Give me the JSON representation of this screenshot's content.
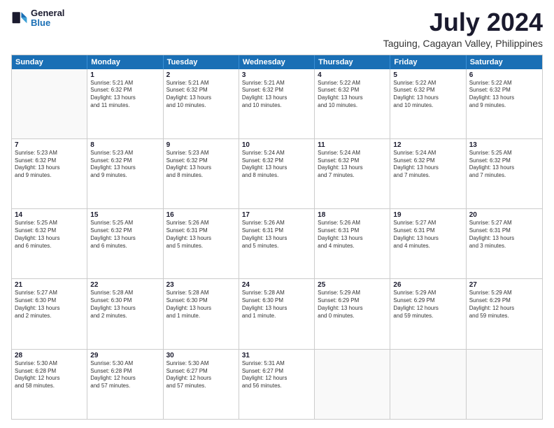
{
  "logo": {
    "line1": "General",
    "line2": "Blue"
  },
  "title": "July 2024",
  "subtitle": "Taguing, Cagayan Valley, Philippines",
  "header": {
    "days": [
      "Sunday",
      "Monday",
      "Tuesday",
      "Wednesday",
      "Thursday",
      "Friday",
      "Saturday"
    ]
  },
  "weeks": [
    [
      {
        "day": "",
        "info": ""
      },
      {
        "day": "1",
        "info": "Sunrise: 5:21 AM\nSunset: 6:32 PM\nDaylight: 13 hours\nand 11 minutes."
      },
      {
        "day": "2",
        "info": "Sunrise: 5:21 AM\nSunset: 6:32 PM\nDaylight: 13 hours\nand 10 minutes."
      },
      {
        "day": "3",
        "info": "Sunrise: 5:21 AM\nSunset: 6:32 PM\nDaylight: 13 hours\nand 10 minutes."
      },
      {
        "day": "4",
        "info": "Sunrise: 5:22 AM\nSunset: 6:32 PM\nDaylight: 13 hours\nand 10 minutes."
      },
      {
        "day": "5",
        "info": "Sunrise: 5:22 AM\nSunset: 6:32 PM\nDaylight: 13 hours\nand 10 minutes."
      },
      {
        "day": "6",
        "info": "Sunrise: 5:22 AM\nSunset: 6:32 PM\nDaylight: 13 hours\nand 9 minutes."
      }
    ],
    [
      {
        "day": "7",
        "info": "Sunrise: 5:23 AM\nSunset: 6:32 PM\nDaylight: 13 hours\nand 9 minutes."
      },
      {
        "day": "8",
        "info": "Sunrise: 5:23 AM\nSunset: 6:32 PM\nDaylight: 13 hours\nand 9 minutes."
      },
      {
        "day": "9",
        "info": "Sunrise: 5:23 AM\nSunset: 6:32 PM\nDaylight: 13 hours\nand 8 minutes."
      },
      {
        "day": "10",
        "info": "Sunrise: 5:24 AM\nSunset: 6:32 PM\nDaylight: 13 hours\nand 8 minutes."
      },
      {
        "day": "11",
        "info": "Sunrise: 5:24 AM\nSunset: 6:32 PM\nDaylight: 13 hours\nand 7 minutes."
      },
      {
        "day": "12",
        "info": "Sunrise: 5:24 AM\nSunset: 6:32 PM\nDaylight: 13 hours\nand 7 minutes."
      },
      {
        "day": "13",
        "info": "Sunrise: 5:25 AM\nSunset: 6:32 PM\nDaylight: 13 hours\nand 7 minutes."
      }
    ],
    [
      {
        "day": "14",
        "info": "Sunrise: 5:25 AM\nSunset: 6:32 PM\nDaylight: 13 hours\nand 6 minutes."
      },
      {
        "day": "15",
        "info": "Sunrise: 5:25 AM\nSunset: 6:32 PM\nDaylight: 13 hours\nand 6 minutes."
      },
      {
        "day": "16",
        "info": "Sunrise: 5:26 AM\nSunset: 6:31 PM\nDaylight: 13 hours\nand 5 minutes."
      },
      {
        "day": "17",
        "info": "Sunrise: 5:26 AM\nSunset: 6:31 PM\nDaylight: 13 hours\nand 5 minutes."
      },
      {
        "day": "18",
        "info": "Sunrise: 5:26 AM\nSunset: 6:31 PM\nDaylight: 13 hours\nand 4 minutes."
      },
      {
        "day": "19",
        "info": "Sunrise: 5:27 AM\nSunset: 6:31 PM\nDaylight: 13 hours\nand 4 minutes."
      },
      {
        "day": "20",
        "info": "Sunrise: 5:27 AM\nSunset: 6:31 PM\nDaylight: 13 hours\nand 3 minutes."
      }
    ],
    [
      {
        "day": "21",
        "info": "Sunrise: 5:27 AM\nSunset: 6:30 PM\nDaylight: 13 hours\nand 2 minutes."
      },
      {
        "day": "22",
        "info": "Sunrise: 5:28 AM\nSunset: 6:30 PM\nDaylight: 13 hours\nand 2 minutes."
      },
      {
        "day": "23",
        "info": "Sunrise: 5:28 AM\nSunset: 6:30 PM\nDaylight: 13 hours\nand 1 minute."
      },
      {
        "day": "24",
        "info": "Sunrise: 5:28 AM\nSunset: 6:30 PM\nDaylight: 13 hours\nand 1 minute."
      },
      {
        "day": "25",
        "info": "Sunrise: 5:29 AM\nSunset: 6:29 PM\nDaylight: 13 hours\nand 0 minutes."
      },
      {
        "day": "26",
        "info": "Sunrise: 5:29 AM\nSunset: 6:29 PM\nDaylight: 12 hours\nand 59 minutes."
      },
      {
        "day": "27",
        "info": "Sunrise: 5:29 AM\nSunset: 6:29 PM\nDaylight: 12 hours\nand 59 minutes."
      }
    ],
    [
      {
        "day": "28",
        "info": "Sunrise: 5:30 AM\nSunset: 6:28 PM\nDaylight: 12 hours\nand 58 minutes."
      },
      {
        "day": "29",
        "info": "Sunrise: 5:30 AM\nSunset: 6:28 PM\nDaylight: 12 hours\nand 57 minutes."
      },
      {
        "day": "30",
        "info": "Sunrise: 5:30 AM\nSunset: 6:27 PM\nDaylight: 12 hours\nand 57 minutes."
      },
      {
        "day": "31",
        "info": "Sunrise: 5:31 AM\nSunset: 6:27 PM\nDaylight: 12 hours\nand 56 minutes."
      },
      {
        "day": "",
        "info": ""
      },
      {
        "day": "",
        "info": ""
      },
      {
        "day": "",
        "info": ""
      }
    ]
  ]
}
